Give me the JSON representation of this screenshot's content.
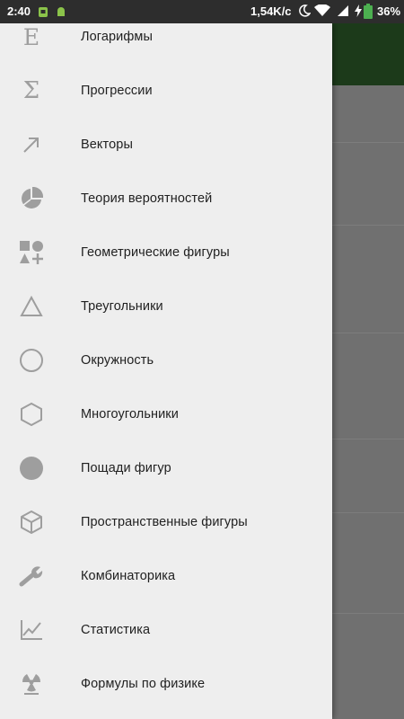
{
  "status_bar": {
    "time": "2:40",
    "network_speed": "1,54K/c",
    "battery_percent": "36%",
    "icons": [
      "android-notification-icon",
      "android-notification-icon",
      "moon-icon",
      "wifi-icon",
      "signal-icon",
      "battery-charging-icon"
    ]
  },
  "colors": {
    "drawer_bg": "#eeeeee",
    "toolbar_green": "#1c3a1a",
    "icon_gray": "#9e9e9e",
    "text": "#212121"
  },
  "drawer": {
    "items": [
      {
        "label": "Логарифмы",
        "icon": "logarithm-icon",
        "glyph": "E"
      },
      {
        "label": "Прогрессии",
        "icon": "sigma-icon",
        "glyph": "Σ"
      },
      {
        "label": "Векторы",
        "icon": "arrow-up-right-icon"
      },
      {
        "label": "Теория вероятностей",
        "icon": "pie-chart-icon"
      },
      {
        "label": "Геометрические фигуры",
        "icon": "shapes-icon"
      },
      {
        "label": "Треугольники",
        "icon": "triangle-icon"
      },
      {
        "label": "Окружность",
        "icon": "circle-outline-icon"
      },
      {
        "label": "Многоугольники",
        "icon": "hexagon-icon"
      },
      {
        "label": "Пощади фигур",
        "icon": "filled-circle-icon"
      },
      {
        "label": "Пространственные фигуры",
        "icon": "cube-icon"
      },
      {
        "label": "Комбинаторика",
        "icon": "wrench-icon"
      },
      {
        "label": "Статистика",
        "icon": "line-chart-icon"
      },
      {
        "label": "Формулы по физике",
        "icon": "radioactive-icon"
      }
    ]
  }
}
